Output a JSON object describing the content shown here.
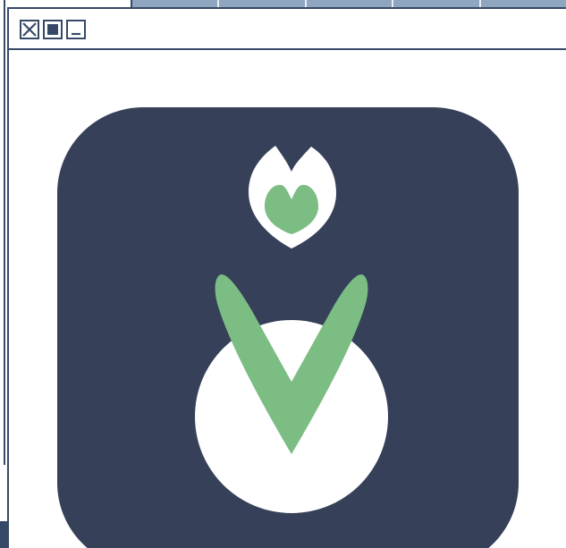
{
  "window": {
    "controls": {
      "close_icon": "close-x-icon",
      "maximize_icon": "filled-square-icon",
      "minimize_icon": "minimize-icon"
    }
  },
  "app_icon": {
    "background_color": "#364059",
    "accent_green": "#7bbd83",
    "white": "#ffffff",
    "symbol": "v-leaf-and-circle-logo"
  },
  "colors": {
    "chrome_dark": "#364a67",
    "chrome_light_blue": "#8ea6bf"
  }
}
